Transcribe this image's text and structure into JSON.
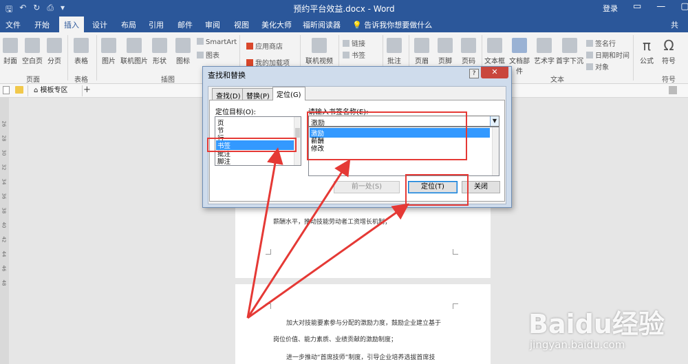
{
  "window": {
    "title": "预约平台效益.docx - Word",
    "login": "登录",
    "share": "共",
    "controls": [
      "▭",
      "—",
      "▢",
      "✕"
    ]
  },
  "ribbon_tabs": [
    "文件",
    "开始",
    "插入",
    "设计",
    "布局",
    "引用",
    "邮件",
    "审阅",
    "视图",
    "美化大师",
    "福昕阅读器"
  ],
  "active_tab": "插入",
  "tell_me": "告诉我你想要做什么",
  "ribbon": {
    "page_group": {
      "label": "页面",
      "buttons": [
        "封面",
        "空白页",
        "分页"
      ]
    },
    "table_group": {
      "label": "表格",
      "buttons": [
        "表格"
      ]
    },
    "illus_group": {
      "label": "插图",
      "buttons": [
        "图片",
        "联机图片",
        "形状",
        "图标"
      ],
      "small": [
        "SmartArt",
        "图表",
        "屏幕截图"
      ]
    },
    "addins": {
      "store": "应用商店",
      "my_addins": "我的加载项"
    },
    "media": {
      "video": "联机视频"
    },
    "links": {
      "link": "链接",
      "bookmark": "书签",
      "crossref": "交叉引用"
    },
    "comment": "批注",
    "header_footer": [
      "页眉",
      "页脚",
      "页码"
    ],
    "text_group": {
      "label": "文本",
      "buttons": [
        "文本框",
        "文档部件",
        "艺术字",
        "首字下沉"
      ],
      "small": [
        "签名行",
        "日期和时间",
        "对象"
      ]
    },
    "symbols_group": {
      "label": "符号",
      "buttons": [
        "公式",
        "符号"
      ]
    }
  },
  "template_bar": {
    "label": "模板专区",
    "add": "+"
  },
  "ruler_numbers": [
    "26",
    "28",
    "30",
    "32",
    "34",
    "36",
    "38",
    "40",
    "42",
    "44",
    "46",
    "48"
  ],
  "dialog": {
    "title": "查找和替换",
    "help": "?",
    "close": "✕",
    "tabs": [
      "查找(D)",
      "替换(P)",
      "定位(G)"
    ],
    "active_tab": "定位(G)",
    "goto_what_label": "定位目标(O):",
    "goto_items": [
      "页",
      "节",
      "行",
      "书签",
      "批注",
      "脚注"
    ],
    "goto_selected": "书签",
    "bookmark_label": "请输入书签名称(E):",
    "bookmark_value": "激励",
    "bookmark_items": [
      "激励",
      "薪酬",
      "修改"
    ],
    "buttons": {
      "prev": "前一处(S)",
      "goto": "定位(T)",
      "close": "关闭"
    }
  },
  "document": {
    "page1_line": "薪酬水平，推动技能劳动者工资增长机制；",
    "page2_lines": [
      "加大对技能要素参与分配的激励力度，鼓励企业建立基于",
      "岗位价值、能力素质、业绩贡献的激励制度；",
      "进一步推动“首席技师”制度，引导企业培养选拔首席技"
    ]
  },
  "watermark": {
    "brand": "Baidu经验",
    "url": "jingyan.baidu.com"
  },
  "colors": {
    "word_blue": "#2b579a",
    "highlight_red": "#e53935",
    "selection_blue": "#3399ff"
  }
}
